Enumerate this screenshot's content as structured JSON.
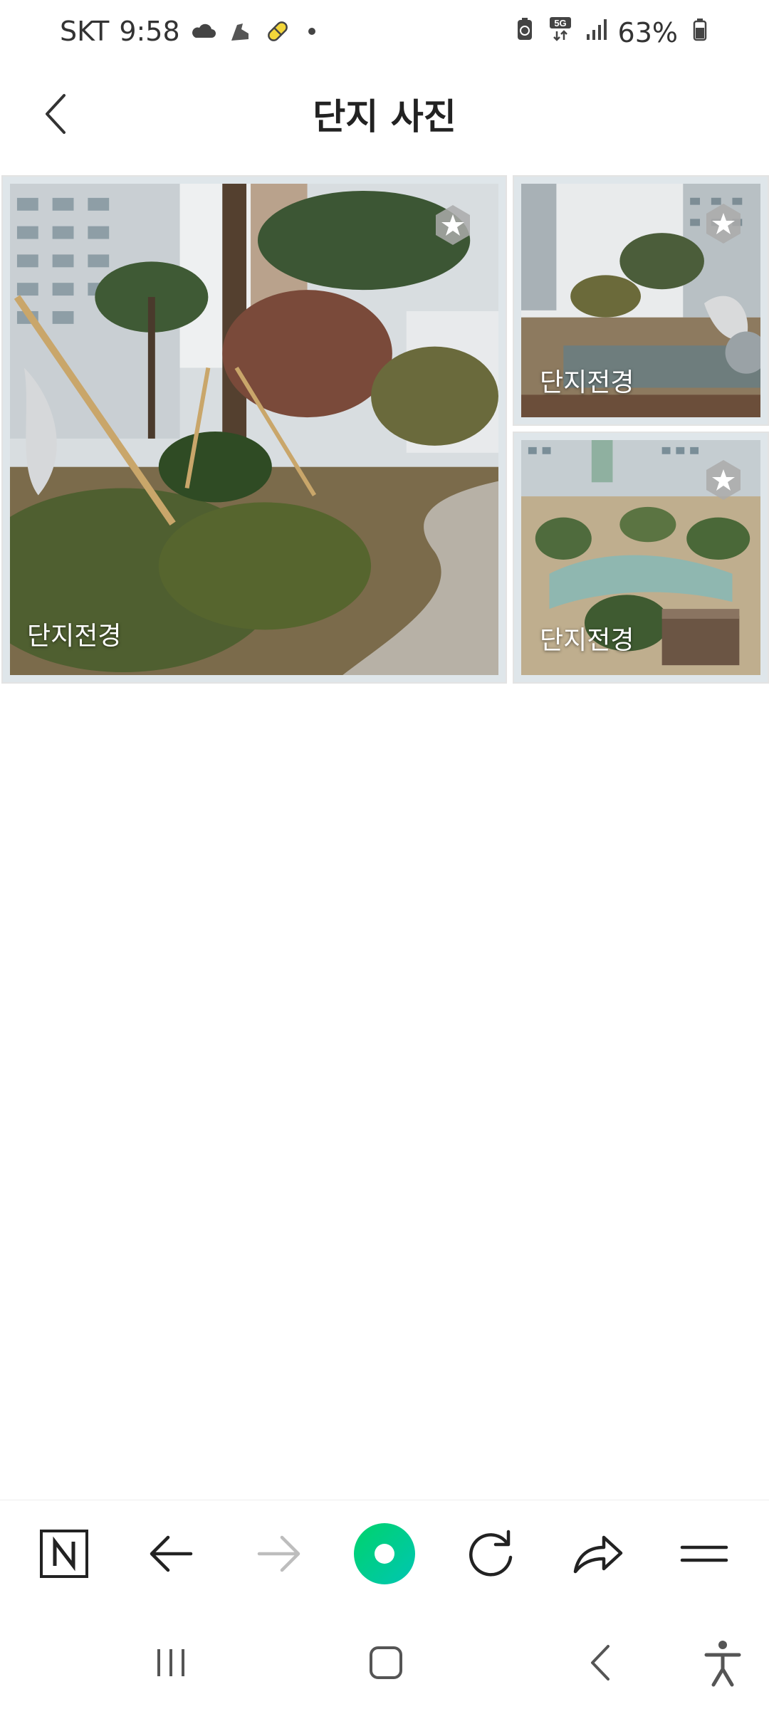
{
  "status_bar": {
    "carrier": "SKT",
    "time": "9:58",
    "network": "5G",
    "battery_percent": "63%",
    "icons": [
      "cloud-icon",
      "running-shoe-icon",
      "pill-icon",
      "dot-icon",
      "battery-saver-icon",
      "5g-data-icon",
      "signal-icon",
      "battery-icon"
    ]
  },
  "header": {
    "title": "단지 사진",
    "back_icon": "chevron-left-icon"
  },
  "gallery": {
    "photos": [
      {
        "label": "단지전경",
        "badge_icon": "star-icon"
      },
      {
        "label": "단지전경",
        "badge_icon": "star-icon"
      },
      {
        "label": "단지전경",
        "badge_icon": "star-icon"
      }
    ]
  },
  "toolbar": {
    "items": [
      "naver-home-icon",
      "back-arrow-icon",
      "forward-arrow-icon",
      "green-dot-icon",
      "refresh-icon",
      "share-icon",
      "menu-icon"
    ],
    "accent_color": "#03c75a"
  },
  "system_nav": {
    "items": [
      "recent-apps-icon",
      "home-icon",
      "back-icon",
      "accessibility-icon"
    ]
  }
}
